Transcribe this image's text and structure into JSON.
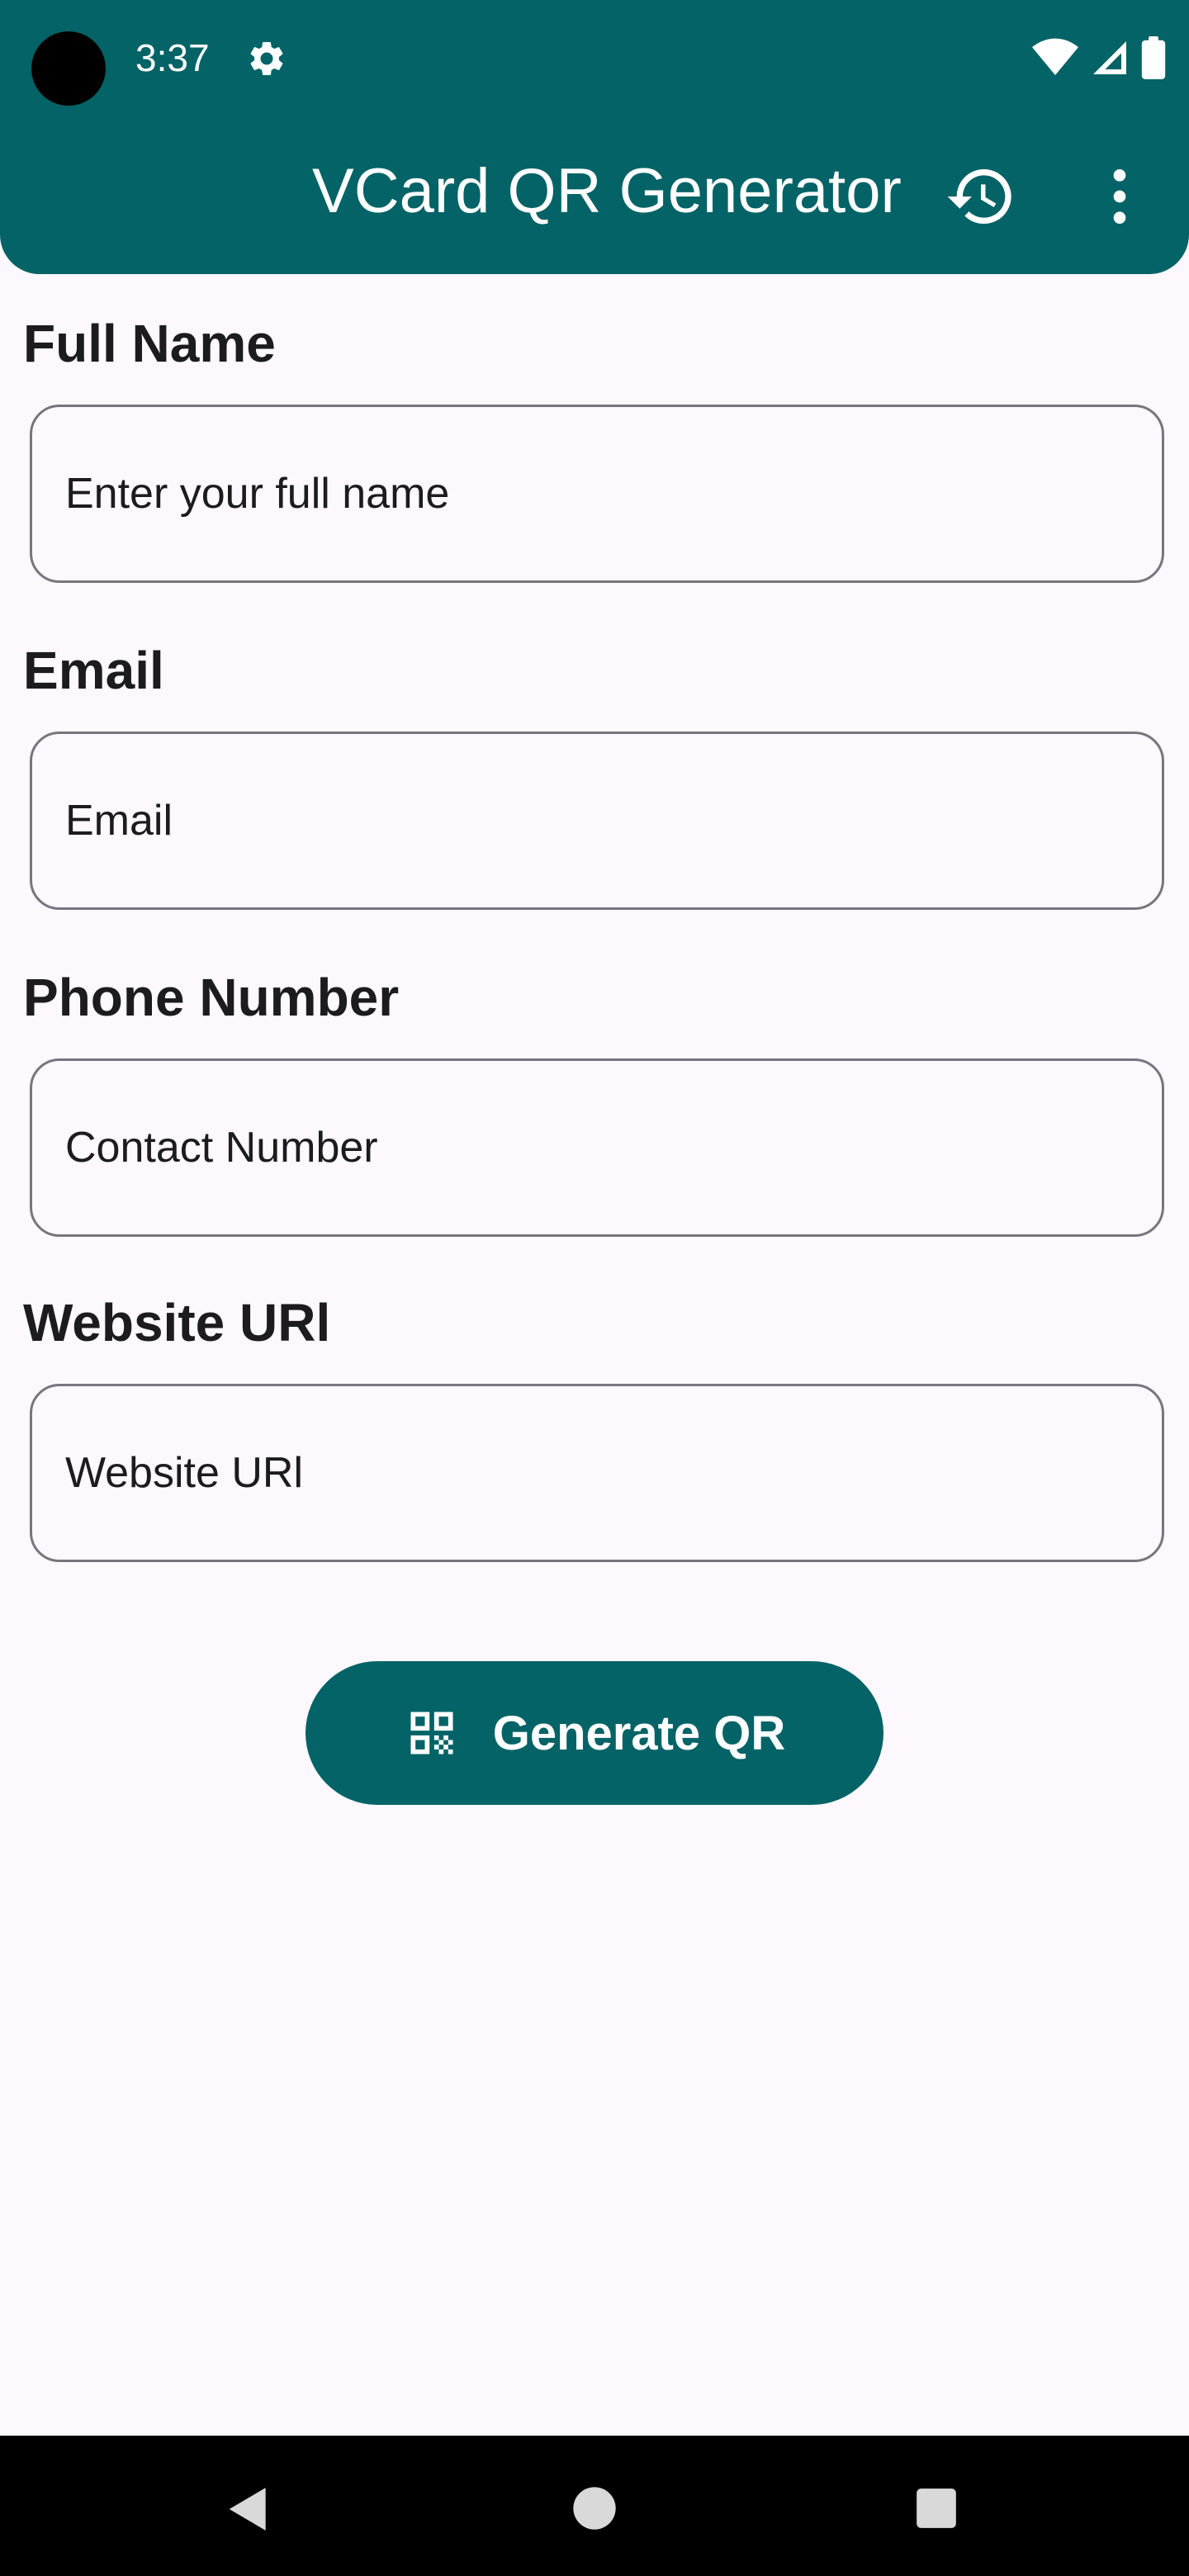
{
  "status_bar": {
    "time": "3:37",
    "icons": [
      "settings-gear-icon",
      "wifi-icon",
      "signal-icon",
      "battery-icon"
    ]
  },
  "app_bar": {
    "title": "VCard QR Generator",
    "actions": [
      "history-icon",
      "more-vert-icon"
    ],
    "color": "#036366"
  },
  "form": {
    "full_name": {
      "label": "Full Name",
      "placeholder": "Enter your full name",
      "value": ""
    },
    "email": {
      "label": "Email",
      "placeholder": "Email",
      "value": ""
    },
    "phone": {
      "label": "Phone Number",
      "placeholder": "Contact Number",
      "value": ""
    },
    "website": {
      "label": "Website URl",
      "placeholder": "Website URl",
      "value": ""
    }
  },
  "generate_button": {
    "label": "Generate QR",
    "icon": "qr-code-icon"
  },
  "nav_bar": {
    "icons": [
      "back-icon",
      "home-icon",
      "recents-icon"
    ]
  },
  "colors": {
    "primary": "#036366",
    "background": "#fdf8fd",
    "text": "#1c1b1f",
    "outline": "#79747e"
  }
}
